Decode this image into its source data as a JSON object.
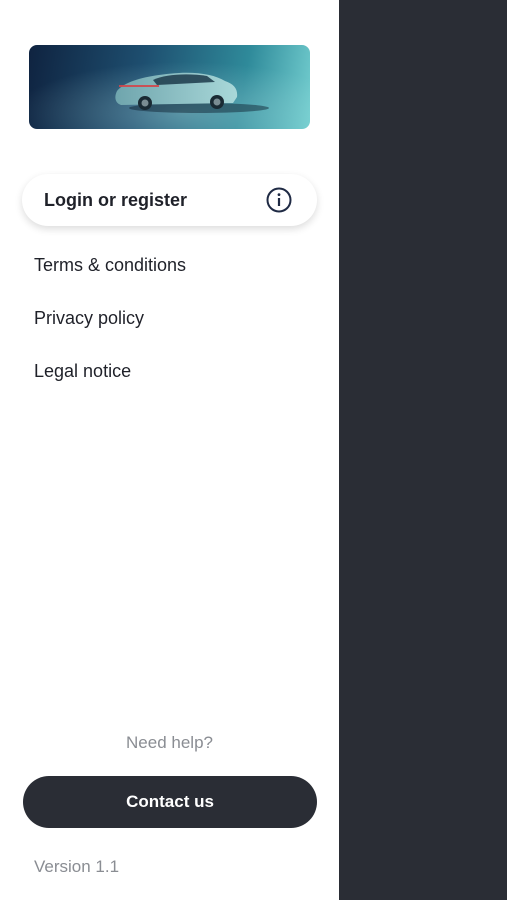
{
  "drawer": {
    "banner_image": "car-banner-image",
    "login": {
      "label": "Login or register",
      "icon": "info-icon"
    },
    "menu_items": [
      {
        "label": "Terms & conditions"
      },
      {
        "label": "Privacy policy"
      },
      {
        "label": "Legal notice"
      }
    ],
    "help_text": "Need help?",
    "contact_label": "Contact us",
    "version": "Version 1.1"
  },
  "colors": {
    "dark": "#2a2d35",
    "text": "#1f2129",
    "muted": "#8a8d93",
    "background": "#ffffff"
  }
}
